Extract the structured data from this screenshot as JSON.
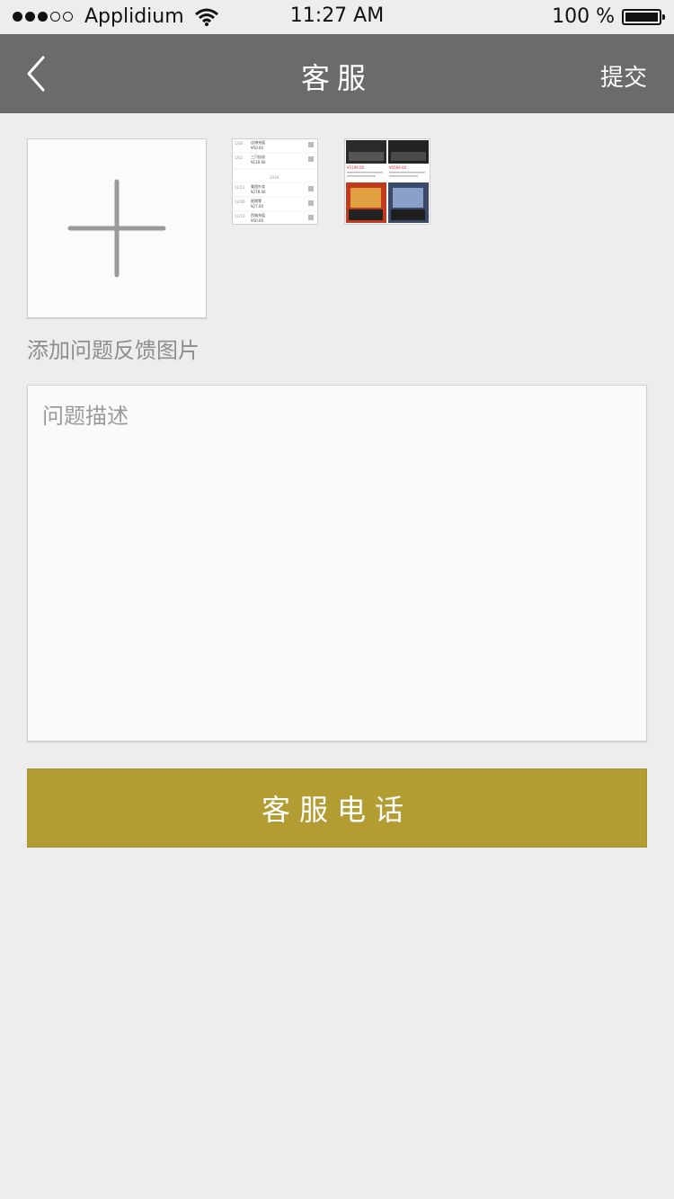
{
  "status_bar": {
    "carrier": "Applidium",
    "time": "11:27 AM",
    "battery": "100 %"
  },
  "nav": {
    "title": "客服",
    "submit_label": "提交"
  },
  "images": {
    "add_label": "添加问题反馈图片",
    "thumbnails": [
      {
        "rows": [
          {
            "date": "1/08",
            "title": "佳博充值",
            "amount": "¥50.00"
          },
          {
            "date": "1/02",
            "title": "三只松鼠",
            "amount": "¥120.66"
          },
          {
            "date": "",
            "title": "2016",
            "amount": ""
          },
          {
            "date": "12/11",
            "title": "美团外卖",
            "amount": "¥278.00"
          },
          {
            "date": "12/06",
            "title": "星期零",
            "amount": "¥27.00"
          },
          {
            "date": "12/10",
            "title": "西城充值",
            "amount": "¥50.00"
          }
        ]
      },
      {
        "prices": [
          "¥5199.00",
          "¥5599.00"
        ]
      }
    ]
  },
  "description": {
    "placeholder": "问题描述",
    "value": ""
  },
  "phone_button_label": "客服电话"
}
